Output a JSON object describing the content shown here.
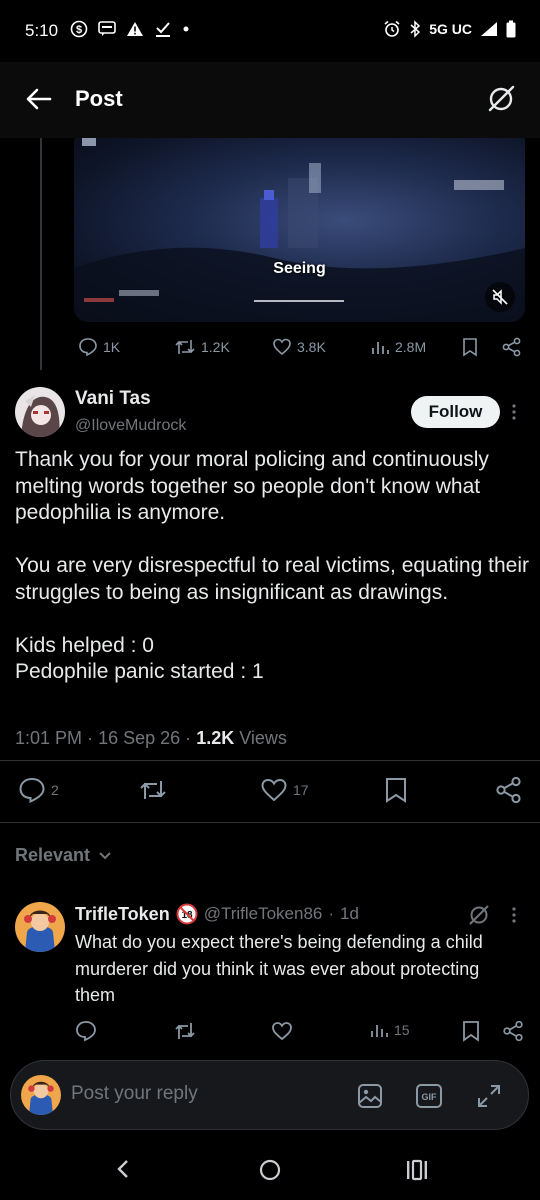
{
  "status_bar": {
    "time": "5:10",
    "network": "5G UC"
  },
  "header": {
    "title": "Post"
  },
  "quoted_post": {
    "video_caption": "Seeing",
    "replies": "1K",
    "reposts": "1.2K",
    "likes": "3.8K",
    "views": "2.8M"
  },
  "post": {
    "author_name": "Vani Tas",
    "author_handle": "@IloveMudrock",
    "follow_label": "Follow",
    "body": "Thank you for your moral policing and continuously melting words together so people don't know what pedophilia is anymore.\n\nYou are very disrespectful to real victims, equating their struggles to being as insignificant as drawings.\n\nKids helped : 0\nPedophile panic started : 1",
    "time": "1:01 PM",
    "date": "16 Sep 26",
    "views_count": "1.2K",
    "views_label": "Views",
    "reply_count": "2",
    "like_count": "17"
  },
  "relevant": {
    "label": "Relevant"
  },
  "reply": {
    "author_name": "TrifleToken",
    "author_handle": "@TrifleToken86",
    "age": "1d",
    "body": "What do you expect there's being defending a child murderer did you think it was ever about protecting them",
    "views": "15"
  },
  "composer": {
    "placeholder": "Post your reply"
  },
  "colors": {
    "background": "#000000",
    "text": "#e7e9ea",
    "muted": "#71767b",
    "divider": "#2f3336",
    "follow_bg": "#eff3f4"
  }
}
